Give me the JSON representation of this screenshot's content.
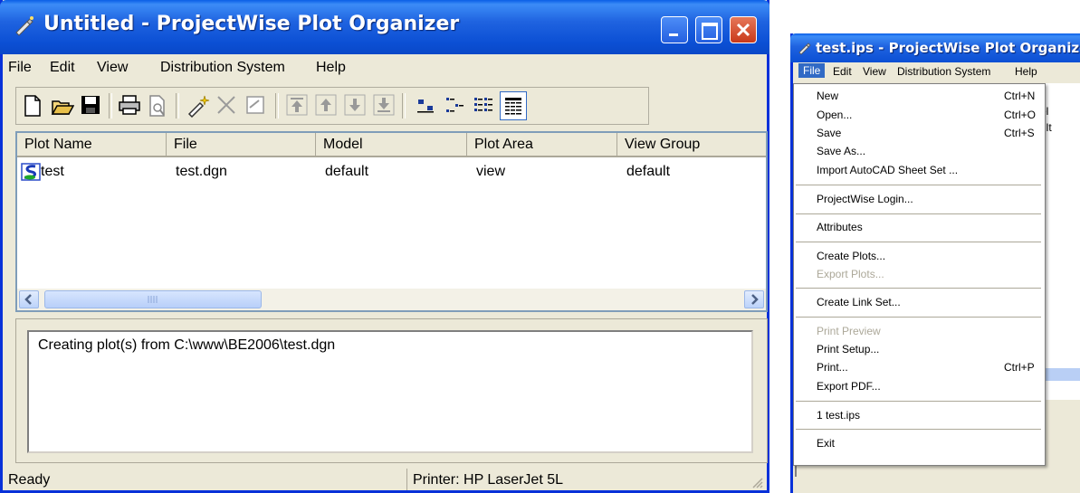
{
  "main_window": {
    "title": "Untitled - ProjectWise Plot Organizer",
    "menu": [
      "File",
      "Edit",
      "View",
      "Distribution System",
      "Help"
    ],
    "columns": [
      "Plot Name",
      "File",
      "Model",
      "Plot Area",
      "View Group"
    ],
    "rows": [
      {
        "plot_name": "test",
        "file": "test.dgn",
        "model": "default",
        "plot_area": "view",
        "view_group": "default"
      }
    ],
    "log_message": "Creating plot(s) from C:\\www\\BE2006\\test.dgn",
    "status_left": "Ready",
    "status_printer": "Printer: HP LaserJet 5L"
  },
  "menu_window": {
    "title": "test.ips - ProjectWise Plot Organizer",
    "menu": [
      "File",
      "Edit",
      "View",
      "Distribution System",
      "Help"
    ],
    "list_fragments": [
      "el",
      "ult"
    ],
    "file_menu": [
      {
        "label": "New",
        "shortcut": "Ctrl+N",
        "enabled": true
      },
      {
        "label": "Open...",
        "shortcut": "Ctrl+O",
        "enabled": true
      },
      {
        "label": "Save",
        "shortcut": "Ctrl+S",
        "enabled": true
      },
      {
        "label": "Save As...",
        "shortcut": "",
        "enabled": true
      },
      {
        "label": "Import AutoCAD Sheet Set ...",
        "shortcut": "",
        "enabled": true
      },
      {
        "label": "ProjectWise Login...",
        "shortcut": "",
        "enabled": true
      },
      {
        "label": "Attributes",
        "shortcut": "",
        "enabled": true
      },
      {
        "label": "Create Plots...",
        "shortcut": "",
        "enabled": true
      },
      {
        "label": "Export Plots...",
        "shortcut": "",
        "enabled": false
      },
      {
        "label": "Create Link Set...",
        "shortcut": "",
        "enabled": true
      },
      {
        "label": "Print Preview",
        "shortcut": "",
        "enabled": false
      },
      {
        "label": "Print Setup...",
        "shortcut": "",
        "enabled": true
      },
      {
        "label": "Print...",
        "shortcut": "Ctrl+P",
        "enabled": true
      },
      {
        "label": "Export PDF...",
        "shortcut": "",
        "enabled": true
      },
      {
        "label": "1 test.ips",
        "shortcut": "",
        "enabled": true
      },
      {
        "label": "Exit",
        "shortcut": "",
        "enabled": true
      }
    ]
  },
  "colors": {
    "titlebar": "#0b4fd4",
    "window_bg": "#ece9d8",
    "menu_highlight": "#316ac5",
    "disabled_text": "#aca899"
  },
  "icons": [
    "app-icon",
    "new-icon",
    "open-icon",
    "save-icon",
    "print-icon",
    "print-preview-icon",
    "wand-icon",
    "delete-icon",
    "properties-icon",
    "move-top-icon",
    "move-up-icon",
    "move-down-icon",
    "move-bottom-icon",
    "large-icons-icon",
    "small-icons-icon",
    "list-icon",
    "details-icon"
  ]
}
